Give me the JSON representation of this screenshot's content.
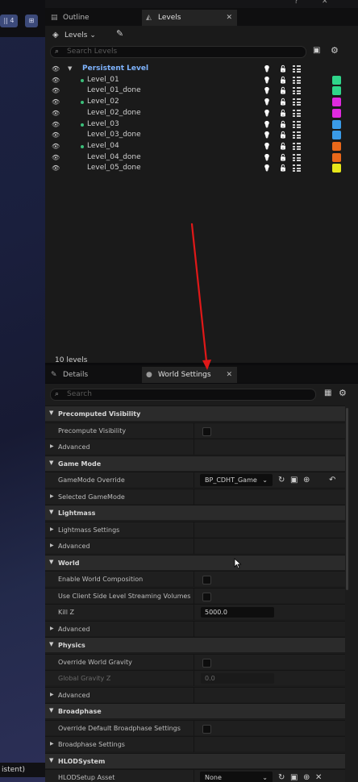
{
  "viewport": {
    "btn_left": "|| 4",
    "btn_right": "⊞",
    "status_text": "istent)"
  },
  "outliner_tabs": [
    {
      "label": "Outline",
      "icon": "outline-icon"
    },
    {
      "label": "Levels",
      "icon": "levels-icon"
    }
  ],
  "levels_toolbar": {
    "levels_button": "Levels",
    "search_placeholder": "Search Levels"
  },
  "levels": [
    {
      "name": "Persistent Level",
      "persistent": true,
      "expander": "▼",
      "color": ""
    },
    {
      "name": "Level_01",
      "dot": true,
      "color": "#2fd58a"
    },
    {
      "name": "Level_01_done",
      "dot": false,
      "color": "#2fd58a"
    },
    {
      "name": "Level_02",
      "dot": true,
      "color": "#e02ae0"
    },
    {
      "name": "Level_02_done",
      "dot": false,
      "color": "#e02ae0"
    },
    {
      "name": "Level_03",
      "dot": true,
      "color": "#3a9be8"
    },
    {
      "name": "Level_03_done",
      "dot": false,
      "color": "#3a9be8"
    },
    {
      "name": "Level_04",
      "dot": true,
      "color": "#e8681a"
    },
    {
      "name": "Level_04_done",
      "dot": false,
      "color": "#e8681a"
    },
    {
      "name": "Level_05_done",
      "dot": false,
      "color": "#e6e61a"
    }
  ],
  "level_count": "10 levels",
  "details_tabs": [
    {
      "label": "Details",
      "icon": "pencil-icon"
    },
    {
      "label": "World Settings",
      "icon": "globe-icon"
    }
  ],
  "details_search": {
    "placeholder": "Search"
  },
  "world_settings": [
    {
      "kind": "section",
      "title": "Precomputed Visibility"
    },
    {
      "kind": "prop",
      "label": "Precompute Visibility",
      "control": "checkbox"
    },
    {
      "kind": "prop",
      "label": "Advanced",
      "expandable": true
    },
    {
      "kind": "section",
      "title": "Game Mode"
    },
    {
      "kind": "prop",
      "label": "GameMode Override",
      "control": "combo",
      "value": "BP_CDHT_Game"
    },
    {
      "kind": "prop",
      "label": "Selected GameMode",
      "expandable": true
    },
    {
      "kind": "section",
      "title": "Lightmass"
    },
    {
      "kind": "prop",
      "label": "Lightmass Settings",
      "expandable": true
    },
    {
      "kind": "prop",
      "label": "Advanced",
      "expandable": true
    },
    {
      "kind": "section",
      "title": "World"
    },
    {
      "kind": "prop",
      "label": "Enable World Composition",
      "control": "checkbox"
    },
    {
      "kind": "prop",
      "label": "Use Client Side Level Streaming Volumes",
      "control": "checkbox"
    },
    {
      "kind": "prop",
      "label": "Kill Z",
      "control": "number",
      "value": "5000.0"
    },
    {
      "kind": "prop",
      "label": "Advanced",
      "expandable": true
    },
    {
      "kind": "section",
      "title": "Physics"
    },
    {
      "kind": "prop",
      "label": "Override World Gravity",
      "control": "checkbox"
    },
    {
      "kind": "prop",
      "label": "Global Gravity Z",
      "control": "number",
      "value": "0.0",
      "disabled": true
    },
    {
      "kind": "prop",
      "label": "Advanced",
      "expandable": true
    },
    {
      "kind": "section",
      "title": "Broadphase"
    },
    {
      "kind": "prop",
      "label": "Override Default Broadphase Settings",
      "control": "checkbox"
    },
    {
      "kind": "prop",
      "label": "Broadphase Settings",
      "expandable": true
    },
    {
      "kind": "section",
      "title": "HLODSystem"
    },
    {
      "kind": "prop",
      "label": "HLODSetup Asset",
      "control": "combo",
      "value": "None"
    }
  ],
  "colors": {
    "persistent_level": "#7fb4ff",
    "annotation_arrow": "#e01818"
  }
}
